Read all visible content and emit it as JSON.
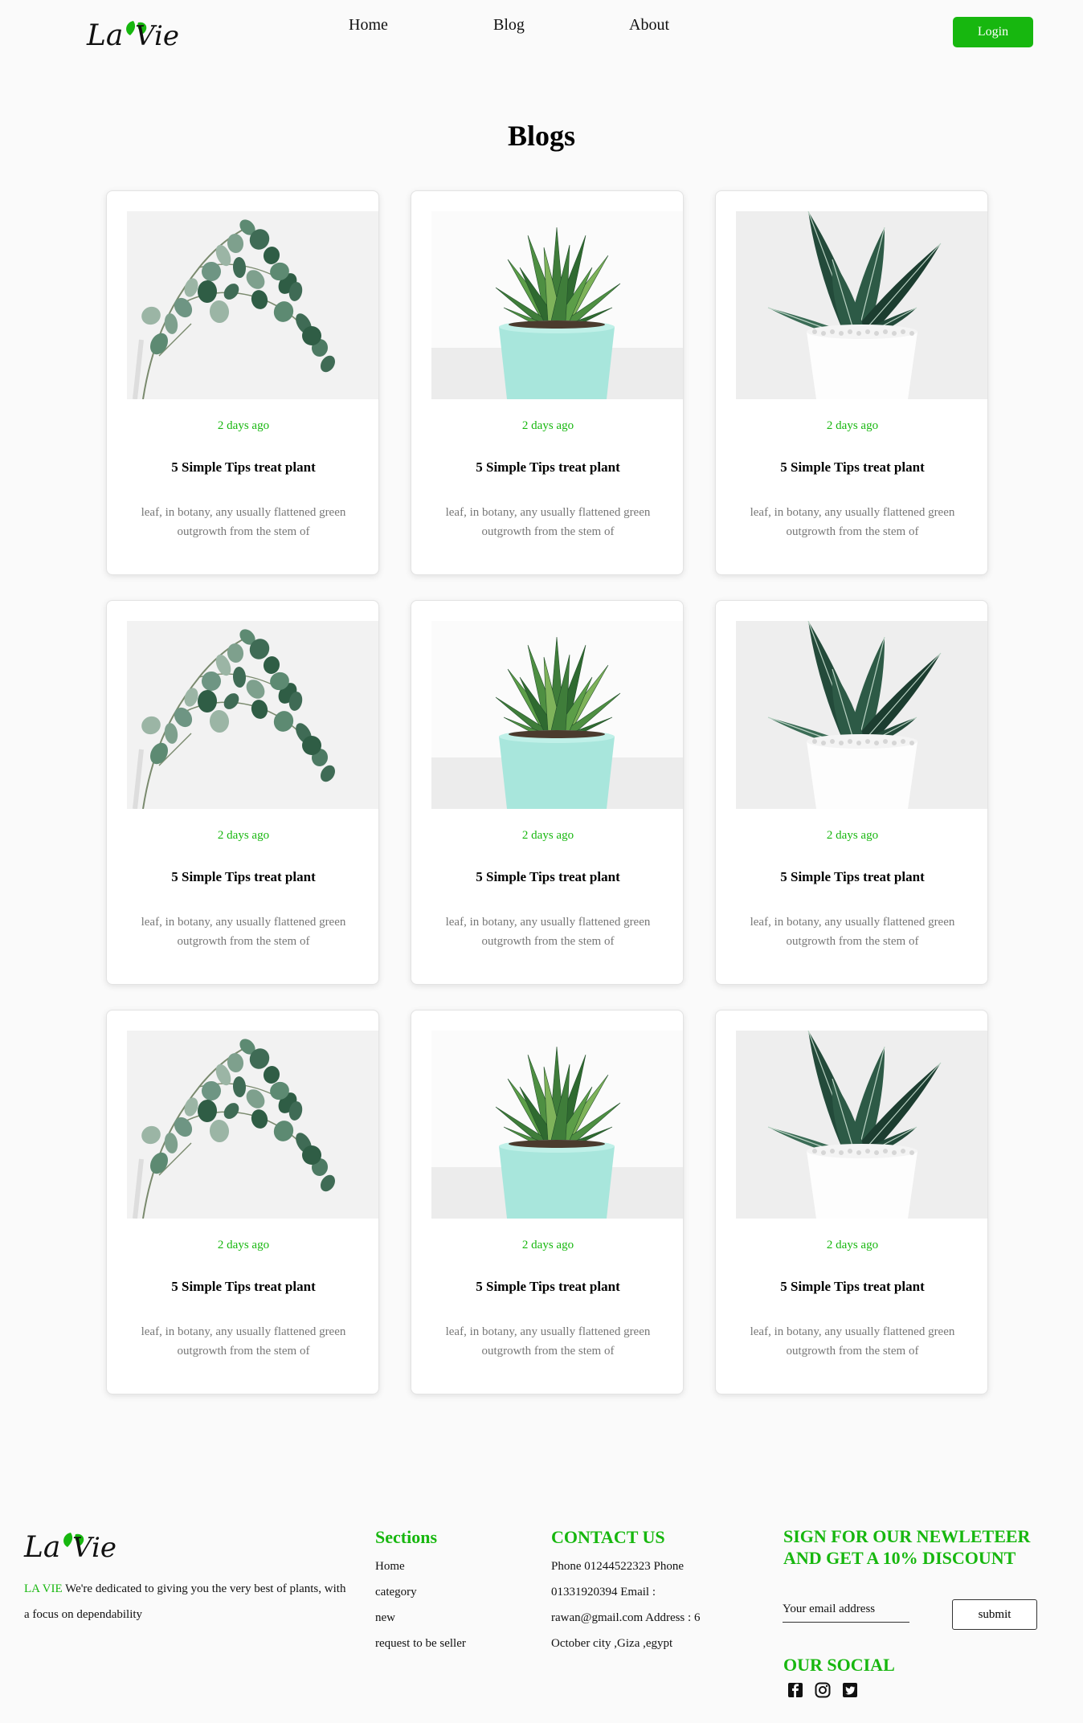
{
  "nav": {
    "logo_text": "La Vie",
    "links": [
      "Home",
      "Blog",
      "About"
    ],
    "login_label": "Login"
  },
  "page": {
    "title": "Blogs"
  },
  "cards": [
    {
      "date": "2 days ago",
      "title": "5 Simple Tips treat plant",
      "desc": "leaf, in botany, any usually flattened green outgrowth from the stem of",
      "image": "eucalyptus-branch"
    },
    {
      "date": "2 days ago",
      "title": "5 Simple Tips treat plant",
      "desc": "leaf, in botany, any usually flattened green outgrowth from the stem of",
      "image": "succulent-teal-pot"
    },
    {
      "date": "2 days ago",
      "title": "5 Simple Tips treat plant",
      "desc": "leaf, in botany, any usually flattened green outgrowth from the stem of",
      "image": "snake-plant-white-pot"
    },
    {
      "date": "2 days ago",
      "title": "5 Simple Tips treat plant",
      "desc": "leaf, in botany, any usually flattened green outgrowth from the stem of",
      "image": "eucalyptus-branch"
    },
    {
      "date": "2 days ago",
      "title": "5 Simple Tips treat plant",
      "desc": "leaf, in botany, any usually flattened green outgrowth from the stem of",
      "image": "succulent-teal-pot"
    },
    {
      "date": "2 days ago",
      "title": "5 Simple Tips treat plant",
      "desc": "leaf, in botany, any usually flattened green outgrowth from the stem of",
      "image": "snake-plant-white-pot"
    },
    {
      "date": "2 days ago",
      "title": "5 Simple Tips treat plant",
      "desc": "leaf, in botany, any usually flattened green outgrowth from the stem of",
      "image": "eucalyptus-branch"
    },
    {
      "date": "2 days ago",
      "title": "5 Simple Tips treat plant",
      "desc": "leaf, in botany, any usually flattened green outgrowth from the stem of",
      "image": "succulent-teal-pot"
    },
    {
      "date": "2 days ago",
      "title": "5 Simple Tips treat plant",
      "desc": "leaf, in botany, any usually flattened green outgrowth from the stem of",
      "image": "snake-plant-white-pot"
    }
  ],
  "footer": {
    "logo_text": "La Vie",
    "brand": "LA VIE",
    "about": " We're dedicated to giving you the very best of plants, with a focus on dependability",
    "sections_heading": "Sections",
    "sections": [
      "Home",
      "category",
      "new",
      "request to be seller"
    ],
    "contact_heading": "CONTACT US",
    "contact_text": "Phone 01244522323 Phone 01331920394 Email : rawan@gmail.com Address : 6 October city ,Giza ,egypt",
    "newsletter_heading": "SIGN FOR OUR NEWLETEER AND GET A 10% DISCOUNT",
    "email_placeholder": "Your email address",
    "submit_label": "submit",
    "social_heading": "OUR SOCIAL",
    "social_icons": [
      "facebook-icon",
      "instagram-icon",
      "twitter-icon"
    ]
  },
  "colors": {
    "accent": "#17b70f",
    "background": "#fafafa"
  }
}
